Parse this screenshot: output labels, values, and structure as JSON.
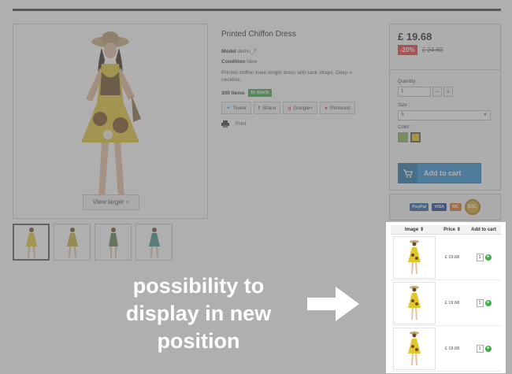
{
  "product": {
    "title": "Printed Chiffon Dress",
    "model_label": "Model",
    "model_value": "demo_7",
    "condition_label": "Condition",
    "condition_value": "New",
    "description": "Printed chiffon knee length dress with tank straps. Deep v-neckline.",
    "items_count": "300 Items",
    "stock_badge": "In stock",
    "view_larger": "View larger"
  },
  "social": {
    "tweet": "Tweet",
    "share": "Share",
    "google": "Google+",
    "pinterest": "Pinterest",
    "print": "Print"
  },
  "buybox": {
    "price": "£ 19.68",
    "discount": "-20%",
    "old_price": "£ 24.60",
    "quantity_label": "Quantity:",
    "quantity_value": "1",
    "size_label": "Size :",
    "size_value": "S",
    "color_label": "Color :",
    "colors": [
      "#7dbb4a",
      "#f2c318"
    ],
    "add_to_cart": "Add to cart"
  },
  "payments": [
    "PayPal",
    "VISA",
    "MasterCard",
    "SSL"
  ],
  "table": {
    "headers": [
      "Image",
      "Price",
      "Add to cart"
    ],
    "rows": [
      {
        "price": "£ 19.68",
        "qty": "1"
      },
      {
        "price": "£ 19.68",
        "qty": "1"
      },
      {
        "price": "£ 19.68",
        "qty": "1"
      }
    ]
  },
  "callout": {
    "line1": "possibility to",
    "line2": "display in new",
    "line3": "position"
  },
  "accent": "#2c8fd3",
  "stock_color": "#46a74e",
  "discount_color": "#f13340"
}
